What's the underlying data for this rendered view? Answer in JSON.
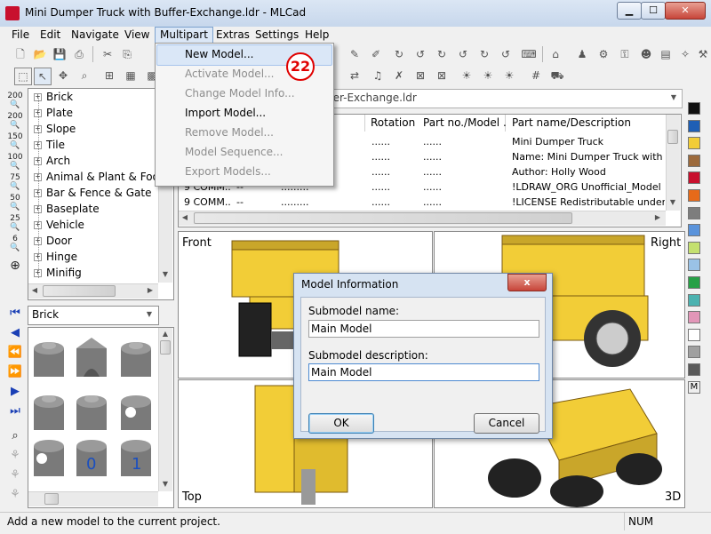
{
  "window": {
    "title": "Mini Dumper Truck with Buffer-Exchange.ldr - MLCad"
  },
  "menubar": [
    "File",
    "Edit",
    "Navigate",
    "View",
    "Multipart",
    "Extras",
    "Settings",
    "Help"
  ],
  "multipart_menu": {
    "items": [
      {
        "label": "New Model...",
        "enabled": true
      },
      {
        "label": "Activate Model...",
        "enabled": false
      },
      {
        "label": "Change Model Info...",
        "enabled": false
      },
      {
        "label": "Import Model...",
        "enabled": true
      },
      {
        "label": "Remove Model...",
        "enabled": false
      },
      {
        "label": "Model Sequence...",
        "enabled": false
      },
      {
        "label": "Export Models...",
        "enabled": false
      }
    ],
    "step_badge": "22"
  },
  "zoom_buttons": [
    "200",
    "200",
    "150",
    "100",
    "75",
    "50",
    "25",
    "6"
  ],
  "parts_tree": [
    "Brick",
    "Plate",
    "Slope",
    "Tile",
    "Arch",
    "Animal & Plant & Food",
    "Bar & Fence & Gate",
    "Baseplate",
    "Vehicle",
    "Door",
    "Hinge",
    "Minifig"
  ],
  "part_category_select": "Brick",
  "model_select": "Mini Dumper Truck with Buffer-Exchange.ldr",
  "table": {
    "columns": [
      "Rotation",
      "Part no./Model ...",
      "Part name/Description"
    ],
    "rows": [
      {
        "type": "",
        "color": "",
        "pos": "",
        "rotation": "......",
        "partno": "......",
        "name": "Mini Dumper Truck"
      },
      {
        "type": "",
        "color": "",
        "pos": "",
        "rotation": "......",
        "partno": "......",
        "name": "Name: Mini Dumper Truck with Buffe"
      },
      {
        "type": "",
        "color": "",
        "pos": "",
        "rotation": "......",
        "partno": "......",
        "name": "Author: Holly Wood"
      },
      {
        "type": "9 COMM...",
        "color": "--",
        "pos": ".........",
        "rotation": "......",
        "partno": "......",
        "name": "!LDRAW_ORG Unofficial_Model"
      },
      {
        "type": "9 COMM...",
        "color": "--",
        "pos": ".........",
        "rotation": "......",
        "partno": "......",
        "name": "!LICENSE Redistributable under CCA"
      }
    ]
  },
  "viewports": {
    "front": "Front",
    "right": "Right",
    "top": "Top",
    "view3d": "3D"
  },
  "dialog": {
    "title": "Model Information",
    "close": "x",
    "name_label": "Submodel name:",
    "name_value": "Main Model",
    "desc_label": "Submodel description:",
    "desc_value": "Main Model",
    "ok": "OK",
    "cancel": "Cancel"
  },
  "palette": [
    "#111111",
    "#1f5fb5",
    "#f2cd37",
    "#9c6a3c",
    "#c8102e",
    "#e66a1a",
    "#7d7d7d",
    "#5a93db",
    "#c4e06f",
    "#9ac2e6",
    "#27a046",
    "#4bb2b0",
    "#e296b8",
    "#ffffff",
    "#a0a0a0",
    "#5a5a5a",
    "M"
  ],
  "statusbar": {
    "text": "Add a new model to the current project.",
    "num": "NUM"
  }
}
